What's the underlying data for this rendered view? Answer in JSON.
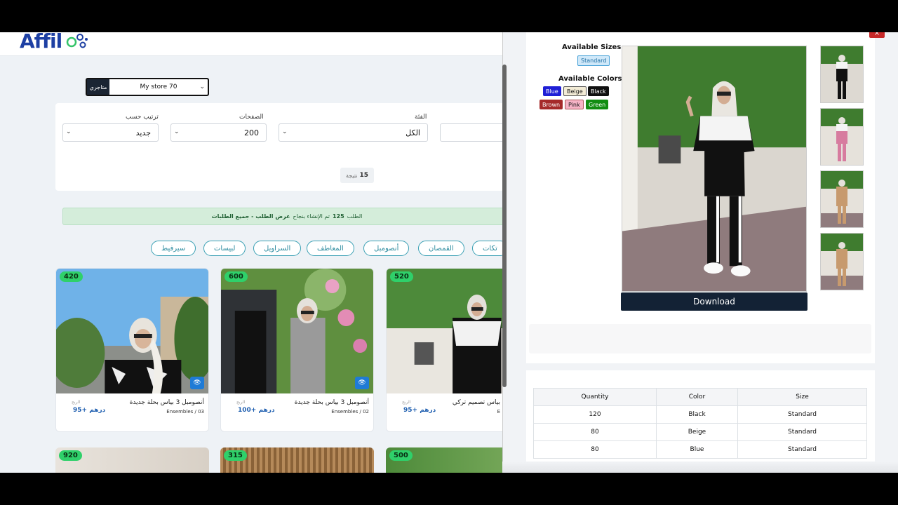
{
  "header": {
    "logo": "Affil"
  },
  "store": {
    "tag": "متاجري",
    "value": "My store 70"
  },
  "filters": {
    "sort": {
      "label": "ترتيب حسب",
      "value": "جديد"
    },
    "pages": {
      "label": "الصفحات",
      "value": "200"
    },
    "category": {
      "label": "الفئة",
      "value": "الكل"
    },
    "results_count": "15",
    "results_label": "نتيجة"
  },
  "success": {
    "prefix": "الطلب",
    "order_no": "125",
    "middle": "تم الإنشاء بنجاح",
    "view_link": "عرض الطلب - جميع الطلبات"
  },
  "chips": [
    "سيرفيط",
    "لبيسات",
    "السراويل",
    "المعاطف",
    "أنصومبل",
    "القمصان",
    "تكات"
  ],
  "products": [
    {
      "badge": "420",
      "title": "أنصومبل 3 بياس بحلة جديدة",
      "category": "Ensembles / 03",
      "margin_label": "الربح",
      "price": "95+ درهم"
    },
    {
      "badge": "600",
      "title": "أنصومبل 3 بياس بحلة جديدة",
      "category": "Ensembles / 02",
      "margin_label": "الربح",
      "price": "100+ درهم"
    },
    {
      "badge": "520",
      "title": "بياس تصميم تركي",
      "category": "E",
      "margin_label": "الربح",
      "price": "95+ درهم"
    }
  ],
  "products_row2": [
    {
      "badge": "920"
    },
    {
      "badge": "315"
    },
    {
      "badge": "500"
    }
  ],
  "modal": {
    "close": "×",
    "sizes_title": "Available Sizes",
    "sizes": [
      "Standard"
    ],
    "colors_title": "Available Colors",
    "colors_row1": [
      {
        "name": "Blue",
        "bg": "#1f1fd6",
        "fg": "#ffffff"
      },
      {
        "name": "Beige",
        "bg": "#f3ecd6",
        "fg": "#111111"
      },
      {
        "name": "Black",
        "bg": "#111111",
        "fg": "#ffffff"
      }
    ],
    "colors_row2": [
      {
        "name": "Brown",
        "bg": "#a52a2a",
        "fg": "#ffffff"
      },
      {
        "name": "Pink",
        "bg": "#f6b3c6",
        "fg": "#111111"
      },
      {
        "name": "Green",
        "bg": "#118d11",
        "fg": "#ffffff"
      }
    ],
    "download": "Download",
    "table": {
      "headers": [
        "Quantity",
        "Color",
        "Size"
      ],
      "rows": [
        [
          "120",
          "Black",
          "Standard"
        ],
        [
          "80",
          "Beige",
          "Standard"
        ],
        [
          "80",
          "Blue",
          "Standard"
        ]
      ]
    }
  },
  "colors": {
    "brand": "#1d3fa3",
    "accent_teal": "#2a8a9e",
    "badge_green": "#2fd06a",
    "dark_button": "#132235"
  }
}
